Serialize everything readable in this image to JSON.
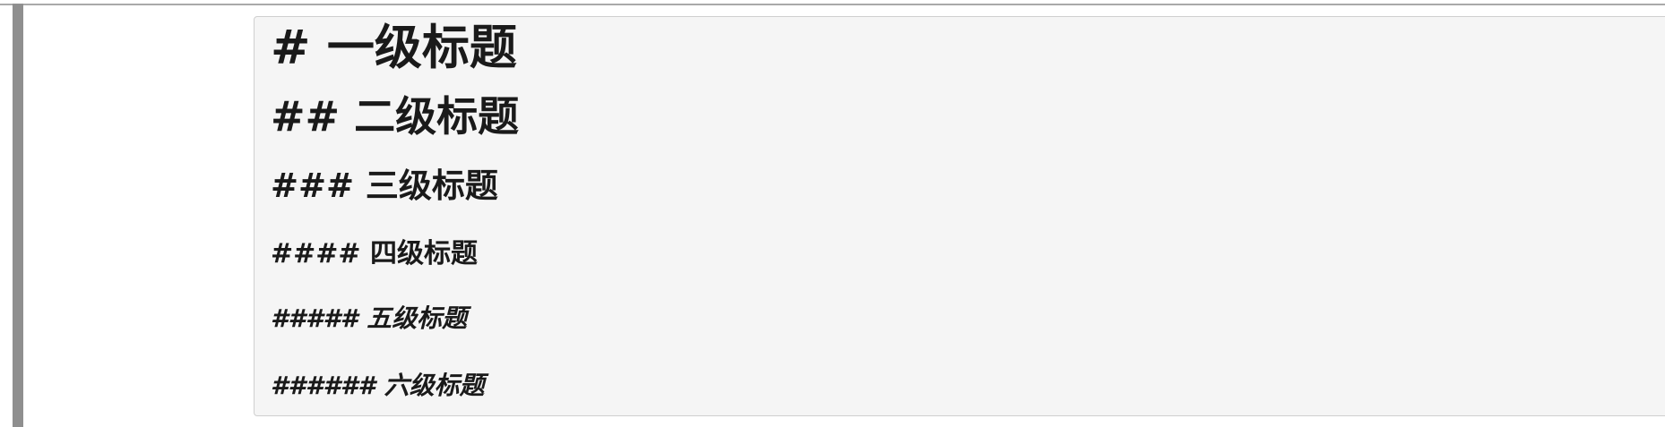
{
  "markdown_block": {
    "lines": [
      "# 一级标题",
      "## 二级标题",
      "### 三级标题",
      "#### 四级标题",
      "##### 五级标题",
      "###### 六级标题"
    ]
  },
  "colors": {
    "background": "#ffffff",
    "code_box_background": "#f5f5f5",
    "code_box_border": "#cfcfcf",
    "left_bar": "#8f8f8f",
    "text": "#1a1a1a"
  }
}
